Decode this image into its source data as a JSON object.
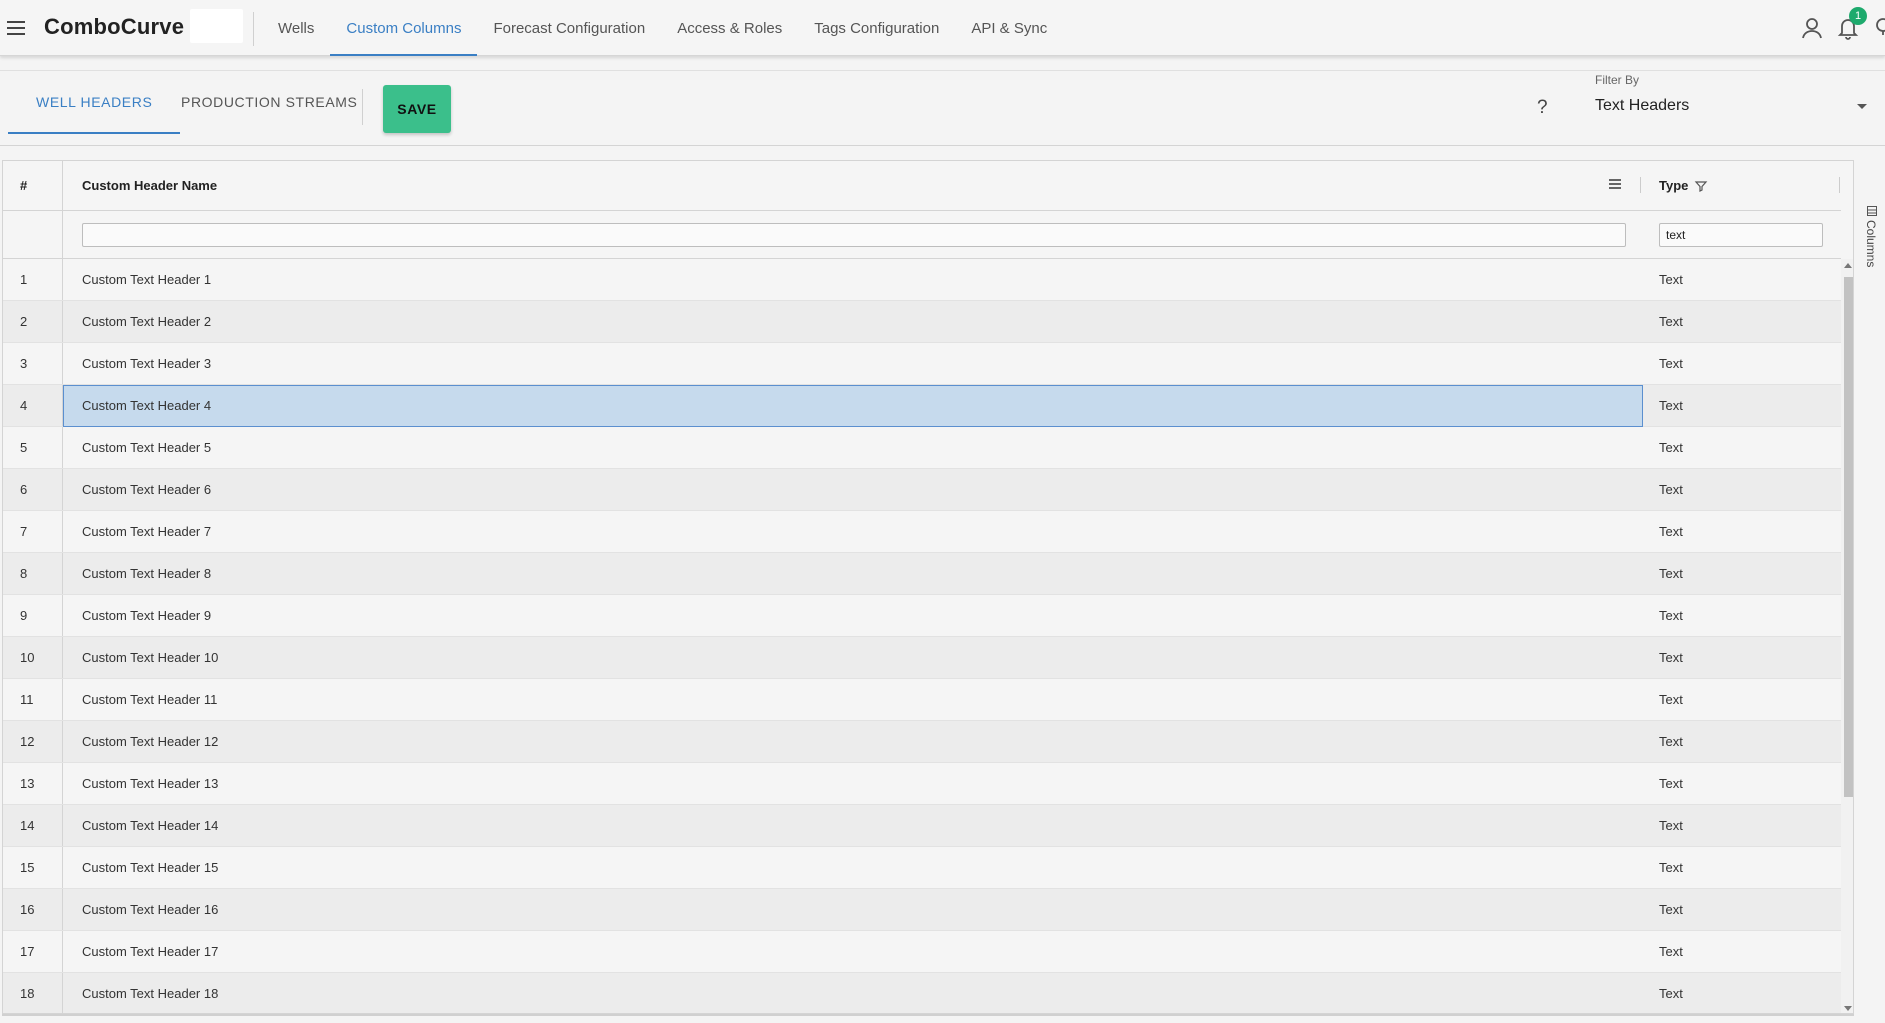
{
  "app": {
    "brand": "ComboCurve",
    "nav_tabs": [
      {
        "label": "Wells",
        "active": false
      },
      {
        "label": "Custom Columns",
        "active": true
      },
      {
        "label": "Forecast Configuration",
        "active": false
      },
      {
        "label": "Access & Roles",
        "active": false
      },
      {
        "label": "Tags Configuration",
        "active": false
      },
      {
        "label": "API & Sync",
        "active": false
      }
    ],
    "notification_count": "1",
    "icons": [
      "menu-icon",
      "user-icon",
      "bell-icon",
      "help-icon"
    ]
  },
  "toolbar": {
    "tabs": [
      {
        "label": "WELL HEADERS",
        "active": true
      },
      {
        "label": "PRODUCTION STREAMS",
        "active": false
      }
    ],
    "save_label": "SAVE",
    "help_label": "?",
    "filter_label": "Filter By",
    "filter_value": "Text Headers"
  },
  "grid": {
    "headers": {
      "num": "#",
      "name": "Custom Header Name",
      "type": "Type"
    },
    "filters": {
      "name": "",
      "type": "text"
    },
    "side_panel_label": "Columns",
    "selected_row": 4,
    "rows": [
      {
        "num": "1",
        "name": "Custom Text Header 1",
        "type": "Text"
      },
      {
        "num": "2",
        "name": "Custom Text Header 2",
        "type": "Text"
      },
      {
        "num": "3",
        "name": "Custom Text Header 3",
        "type": "Text"
      },
      {
        "num": "4",
        "name": "Custom Text Header 4",
        "type": "Text"
      },
      {
        "num": "5",
        "name": "Custom Text Header 5",
        "type": "Text"
      },
      {
        "num": "6",
        "name": "Custom Text Header 6",
        "type": "Text"
      },
      {
        "num": "7",
        "name": "Custom Text Header 7",
        "type": "Text"
      },
      {
        "num": "8",
        "name": "Custom Text Header 8",
        "type": "Text"
      },
      {
        "num": "9",
        "name": "Custom Text Header 9",
        "type": "Text"
      },
      {
        "num": "10",
        "name": "Custom Text Header 10",
        "type": "Text"
      },
      {
        "num": "11",
        "name": "Custom Text Header 11",
        "type": "Text"
      },
      {
        "num": "12",
        "name": "Custom Text Header 12",
        "type": "Text"
      },
      {
        "num": "13",
        "name": "Custom Text Header 13",
        "type": "Text"
      },
      {
        "num": "14",
        "name": "Custom Text Header 14",
        "type": "Text"
      },
      {
        "num": "15",
        "name": "Custom Text Header 15",
        "type": "Text"
      },
      {
        "num": "16",
        "name": "Custom Text Header 16",
        "type": "Text"
      },
      {
        "num": "17",
        "name": "Custom Text Header 17",
        "type": "Text"
      },
      {
        "num": "18",
        "name": "Custom Text Header 18",
        "type": "Text"
      }
    ]
  },
  "colors": {
    "accent": "#3a7fc4",
    "save": "#3bbf8b",
    "selection": "#c6daed",
    "badge": "#1eaa6d"
  }
}
